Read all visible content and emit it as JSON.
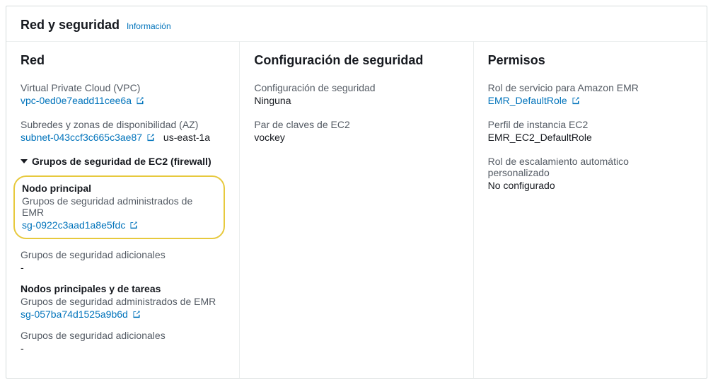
{
  "panel": {
    "title": "Red y seguridad",
    "info_label": "Información"
  },
  "network": {
    "heading": "Red",
    "vpc": {
      "label": "Virtual Private Cloud (VPC)",
      "link_text": "vpc-0ed0e7eadd11cee6a"
    },
    "subnets": {
      "label": "Subredes y zonas de disponibilidad (AZ)",
      "link_text": "subnet-043ccf3c665c3ae87",
      "az_text": "us-east-1a"
    },
    "sg_toggle": "Grupos de seguridad de EC2 (firewall)",
    "primary_node": {
      "title": "Nodo principal",
      "managed_label": "Grupos de seguridad administrados de EMR",
      "sg_link": "sg-0922c3aad1a8e5fdc"
    },
    "additional_sg1": {
      "label": "Grupos de seguridad adicionales",
      "value": "-"
    },
    "task_nodes": {
      "title": "Nodos principales y de tareas",
      "managed_label": "Grupos de seguridad administrados de EMR",
      "sg_link": "sg-057ba74d1525a9b6d"
    },
    "additional_sg2": {
      "label": "Grupos de seguridad adicionales",
      "value": "-"
    }
  },
  "security": {
    "heading": "Configuración de seguridad",
    "config": {
      "label": "Configuración de seguridad",
      "value": "Ninguna"
    },
    "keypair": {
      "label": "Par de claves de EC2",
      "value": "vockey"
    }
  },
  "permissions": {
    "heading": "Permisos",
    "service_role": {
      "label": "Rol de servicio para Amazon EMR",
      "link_text": "EMR_DefaultRole"
    },
    "instance_profile": {
      "label": "Perfil de instancia EC2",
      "value": "EMR_EC2_DefaultRole"
    },
    "autoscale_role": {
      "label": "Rol de escalamiento automático personalizado",
      "value": "No configurado"
    }
  }
}
